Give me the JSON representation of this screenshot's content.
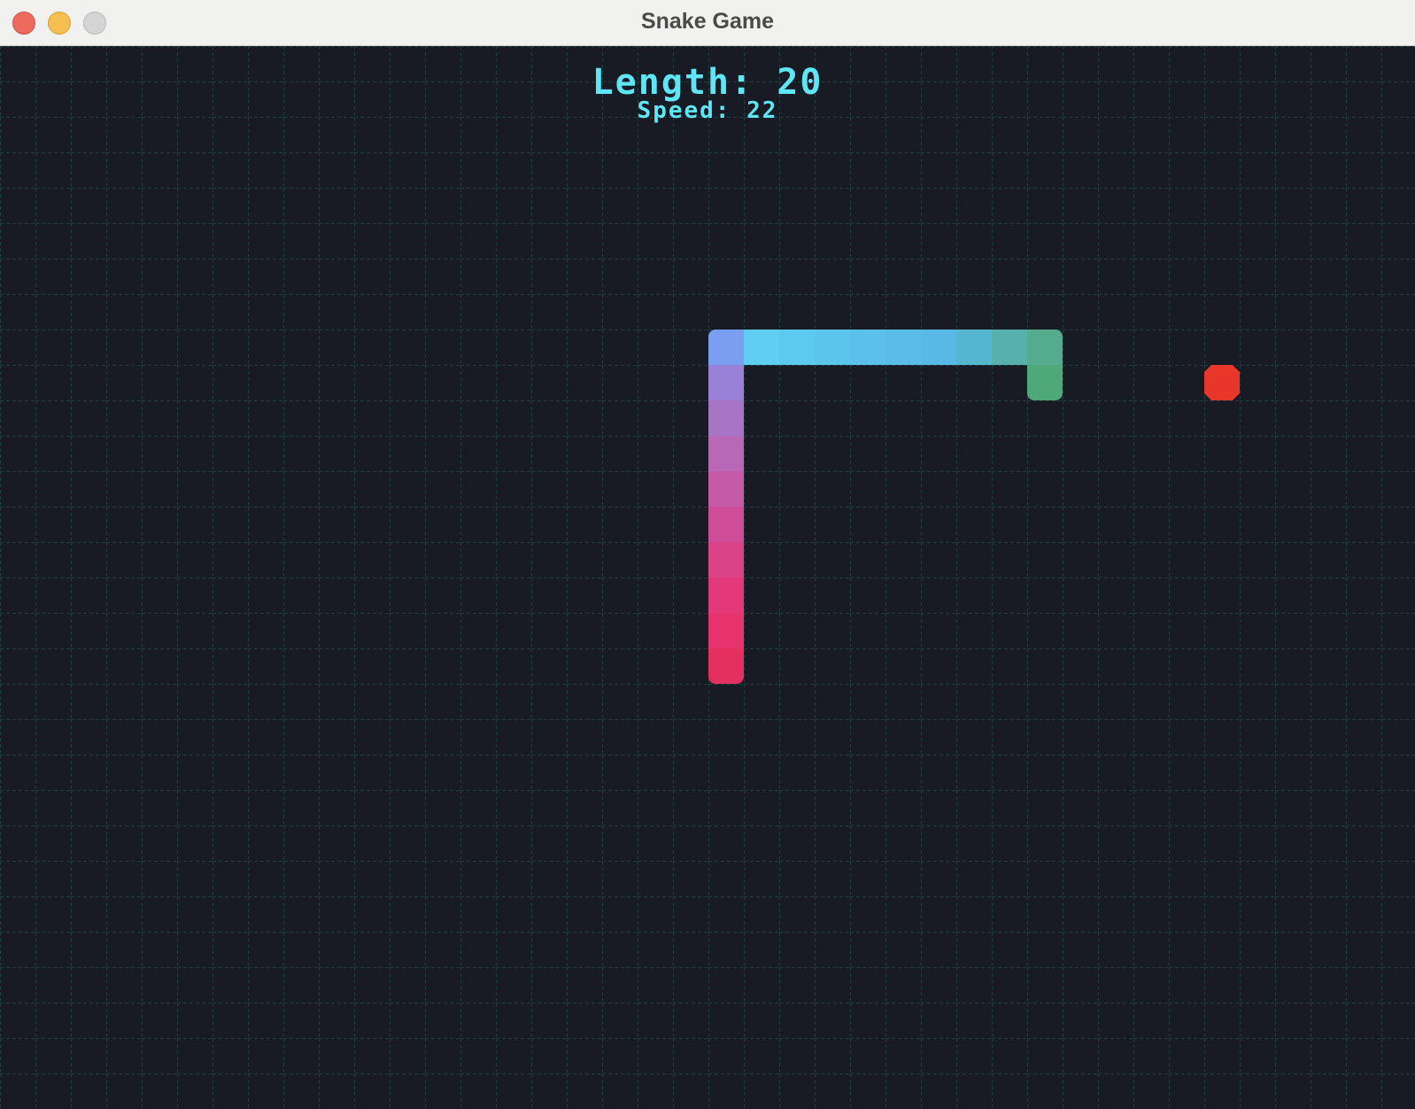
{
  "window": {
    "title": "Snake Game"
  },
  "hud": {
    "length_label": "Length:",
    "length_value": "20",
    "speed_label": "Speed:",
    "speed_value": "22"
  },
  "colors": {
    "background": "#181a24",
    "grid_line": "#1f3f45",
    "hud_text": "#5fe6f4",
    "food": "#e8362a",
    "head": "#4fa877"
  },
  "snake": {
    "length": 20,
    "direction": "down",
    "segments": [
      {
        "col": 29,
        "row": 9,
        "color": "#4fa877"
      },
      {
        "col": 29,
        "row": 8,
        "color": "#55ab8e"
      },
      {
        "col": 28,
        "row": 8,
        "color": "#58b0ad"
      },
      {
        "col": 27,
        "row": 8,
        "color": "#56b5cf"
      },
      {
        "col": 26,
        "row": 8,
        "color": "#58b9e6"
      },
      {
        "col": 25,
        "row": 8,
        "color": "#5abde8"
      },
      {
        "col": 24,
        "row": 8,
        "color": "#5bc1ea"
      },
      {
        "col": 23,
        "row": 8,
        "color": "#5cc5ec"
      },
      {
        "col": 22,
        "row": 8,
        "color": "#5ec9ef"
      },
      {
        "col": 21,
        "row": 8,
        "color": "#60cdf2"
      },
      {
        "col": 20,
        "row": 8,
        "color": "#7a9ff0"
      },
      {
        "col": 20,
        "row": 9,
        "color": "#9881d6"
      },
      {
        "col": 20,
        "row": 10,
        "color": "#a774c6"
      },
      {
        "col": 20,
        "row": 11,
        "color": "#b868b7"
      },
      {
        "col": 20,
        "row": 12,
        "color": "#c45aa8"
      },
      {
        "col": 20,
        "row": 13,
        "color": "#cf4d98"
      },
      {
        "col": 20,
        "row": 14,
        "color": "#db4389"
      },
      {
        "col": 20,
        "row": 15,
        "color": "#e3397b"
      },
      {
        "col": 20,
        "row": 16,
        "color": "#e6336e"
      },
      {
        "col": 20,
        "row": 17,
        "color": "#e4305f"
      }
    ]
  },
  "food": {
    "col": 34,
    "row": 9
  }
}
